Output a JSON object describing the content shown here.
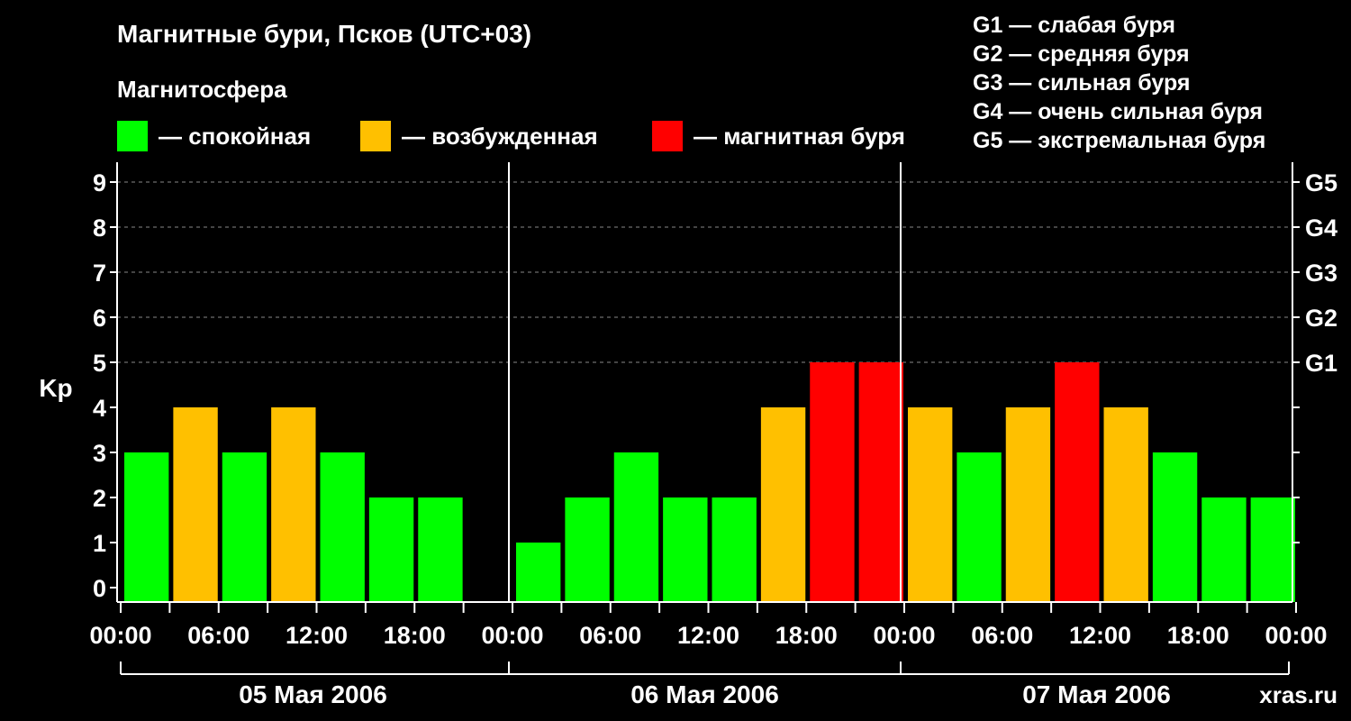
{
  "title": "Магнитные бури, Псков (UTC+03)",
  "subtitle": "Магнитосфера",
  "legend": [
    {
      "label": "— спокойная",
      "color": "#00ff00"
    },
    {
      "label": "— возбужденная",
      "color": "#ffc000"
    },
    {
      "label": "— магнитная буря",
      "color": "#ff0000"
    }
  ],
  "storm_scale": [
    "G1 — слабая буря",
    "G2 — средняя буря",
    "G3 — сильная буря",
    "G4 — очень сильная буря",
    "G5 — экстремальная буря"
  ],
  "watermark": "xras.ru",
  "chart_data": {
    "type": "bar",
    "ylabel": "Kp",
    "ylim": [
      0,
      9
    ],
    "yticks": [
      "0",
      "1",
      "2",
      "3",
      "4",
      "5",
      "6",
      "7",
      "8",
      "9"
    ],
    "right_ticks": [
      {
        "kp": 5,
        "label": "G1"
      },
      {
        "kp": 6,
        "label": "G2"
      },
      {
        "kp": 7,
        "label": "G3"
      },
      {
        "kp": 8,
        "label": "G4"
      },
      {
        "kp": 9,
        "label": "G5"
      }
    ],
    "grid": true,
    "xtick_labels": [
      "00:00",
      "06:00",
      "12:00",
      "18:00",
      "00:00",
      "06:00",
      "12:00",
      "18:00",
      "00:00",
      "06:00",
      "12:00",
      "18:00",
      "00:00"
    ],
    "days": [
      "05 Мая 2006",
      "06 Мая 2006",
      "07 Мая 2006"
    ],
    "interval_hours": 3,
    "values": [
      3,
      4,
      3,
      4,
      3,
      2,
      2,
      null,
      1,
      2,
      3,
      2,
      2,
      4,
      5,
      5,
      4,
      3,
      4,
      5,
      4,
      3,
      2,
      2
    ],
    "levels": [
      "quiet",
      "active",
      "quiet",
      "active",
      "quiet",
      "quiet",
      "quiet",
      null,
      "quiet",
      "quiet",
      "quiet",
      "quiet",
      "quiet",
      "active",
      "storm",
      "storm",
      "active",
      "quiet",
      "active",
      "storm",
      "active",
      "quiet",
      "quiet",
      "quiet"
    ],
    "colors": {
      "quiet": "#00ff00",
      "active": "#ffc000",
      "storm": "#ff0000"
    }
  }
}
